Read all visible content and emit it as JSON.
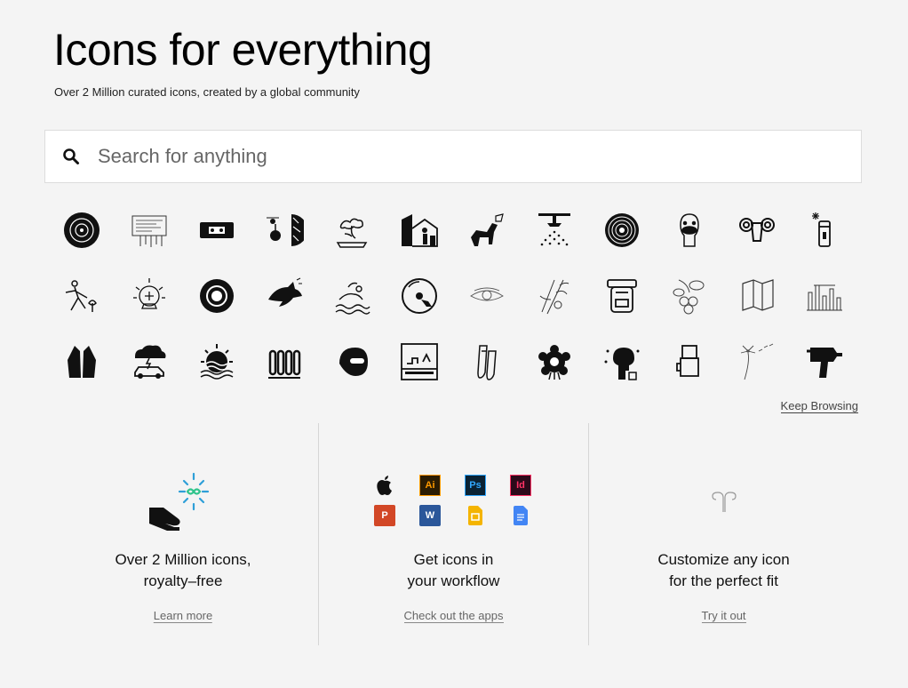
{
  "hero": {
    "title": "Icons for everything",
    "subtitle": "Over 2 Million curated icons, created by a global community"
  },
  "search": {
    "placeholder": "Search for anything",
    "icon": "search-icon"
  },
  "icon_grid": {
    "rows": [
      [
        "hay-bale",
        "receipt",
        "vhs-tape",
        "tire-pressure",
        "bonsai",
        "house-painter",
        "dog-barking",
        "sprinkler",
        "tree-rings",
        "duck-head",
        "ram-head",
        "flashlight"
      ],
      [
        "gardener",
        "crystal-ball",
        "tire",
        "shark-wave",
        "swimmer",
        "cd-music",
        "eye",
        "bamboo",
        "hiking-backpack",
        "berries",
        "map",
        "ruins"
      ],
      [
        "praying-hands",
        "thunderstorm-car",
        "sun-waves",
        "radiator",
        "helmet",
        "billboard",
        "ballet-shoes",
        "pinata",
        "brain-tree",
        "coffee-filter",
        "dandelion",
        "glue-gun"
      ]
    ]
  },
  "keep_browsing": "Keep Browsing",
  "features": [
    {
      "title_line1": "Over 2 Million icons,",
      "title_line2": "royalty–free",
      "link": "Learn more",
      "icon": "hand-infinity-icon"
    },
    {
      "title_line1": "Get icons in",
      "title_line2": "your workflow",
      "link": "Check out the apps",
      "apps": [
        {
          "icon": "apple-icon",
          "label": "",
          "bg": "#ffffff",
          "fg": "#000000"
        },
        {
          "icon": "illustrator-icon",
          "label": "Ai",
          "bg": "#2b1c03",
          "fg": "#ff9a00"
        },
        {
          "icon": "photoshop-icon",
          "label": "Ps",
          "bg": "#0a2233",
          "fg": "#31a8ff"
        },
        {
          "icon": "indesign-icon",
          "label": "Id",
          "bg": "#2c0a1a",
          "fg": "#ff3366"
        },
        {
          "icon": "powerpoint-icon",
          "label": "P",
          "bg": "#d24726",
          "fg": "#ffffff"
        },
        {
          "icon": "word-icon",
          "label": "W",
          "bg": "#2b579a",
          "fg": "#ffffff"
        },
        {
          "icon": "google-slides-icon",
          "label": "",
          "bg": "#f4b400",
          "fg": "#ffffff"
        },
        {
          "icon": "google-docs-icon",
          "label": "",
          "bg": "#4285f4",
          "fg": "#ffffff"
        }
      ]
    },
    {
      "title_line1": "Customize any icon",
      "title_line2": "for the perfect fit",
      "link": "Try it out",
      "icon": "customize-icon"
    }
  ],
  "colors": {
    "background": "#f4f4f4",
    "accent_green": "#31c48d",
    "accent_blue": "#2e9fd8"
  }
}
